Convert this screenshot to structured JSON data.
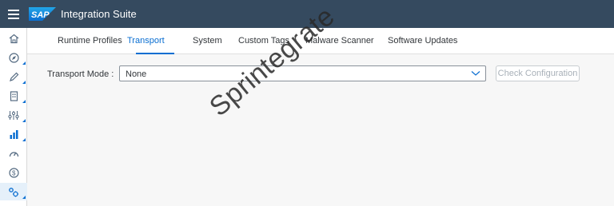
{
  "shell": {
    "logo_text": "SAP",
    "app_title": "Integration Suite"
  },
  "sidenav": {
    "items": [
      {
        "icon": "home-icon"
      },
      {
        "icon": "discover-icon"
      },
      {
        "icon": "design-pencil-icon"
      },
      {
        "icon": "document-icon"
      },
      {
        "icon": "settings-sliders-icon"
      },
      {
        "icon": "monitor-chart-icon"
      },
      {
        "icon": "gauge-icon"
      },
      {
        "icon": "dollar-icon"
      },
      {
        "icon": "gears-icon"
      }
    ]
  },
  "tabs": {
    "items": [
      "Runtime Profiles",
      "Transport",
      "System",
      "Custom Tags",
      "Malware Scanner",
      "Software Updates"
    ],
    "active": "Transport"
  },
  "transport": {
    "label": "Transport Mode :",
    "value": "None",
    "check_button": "Check Configuration"
  },
  "watermark": "Sprintegrate",
  "colors": {
    "shell_bg": "#354a5f",
    "accent": "#0a6ed1",
    "logo_bg": "#1a8fd9"
  }
}
